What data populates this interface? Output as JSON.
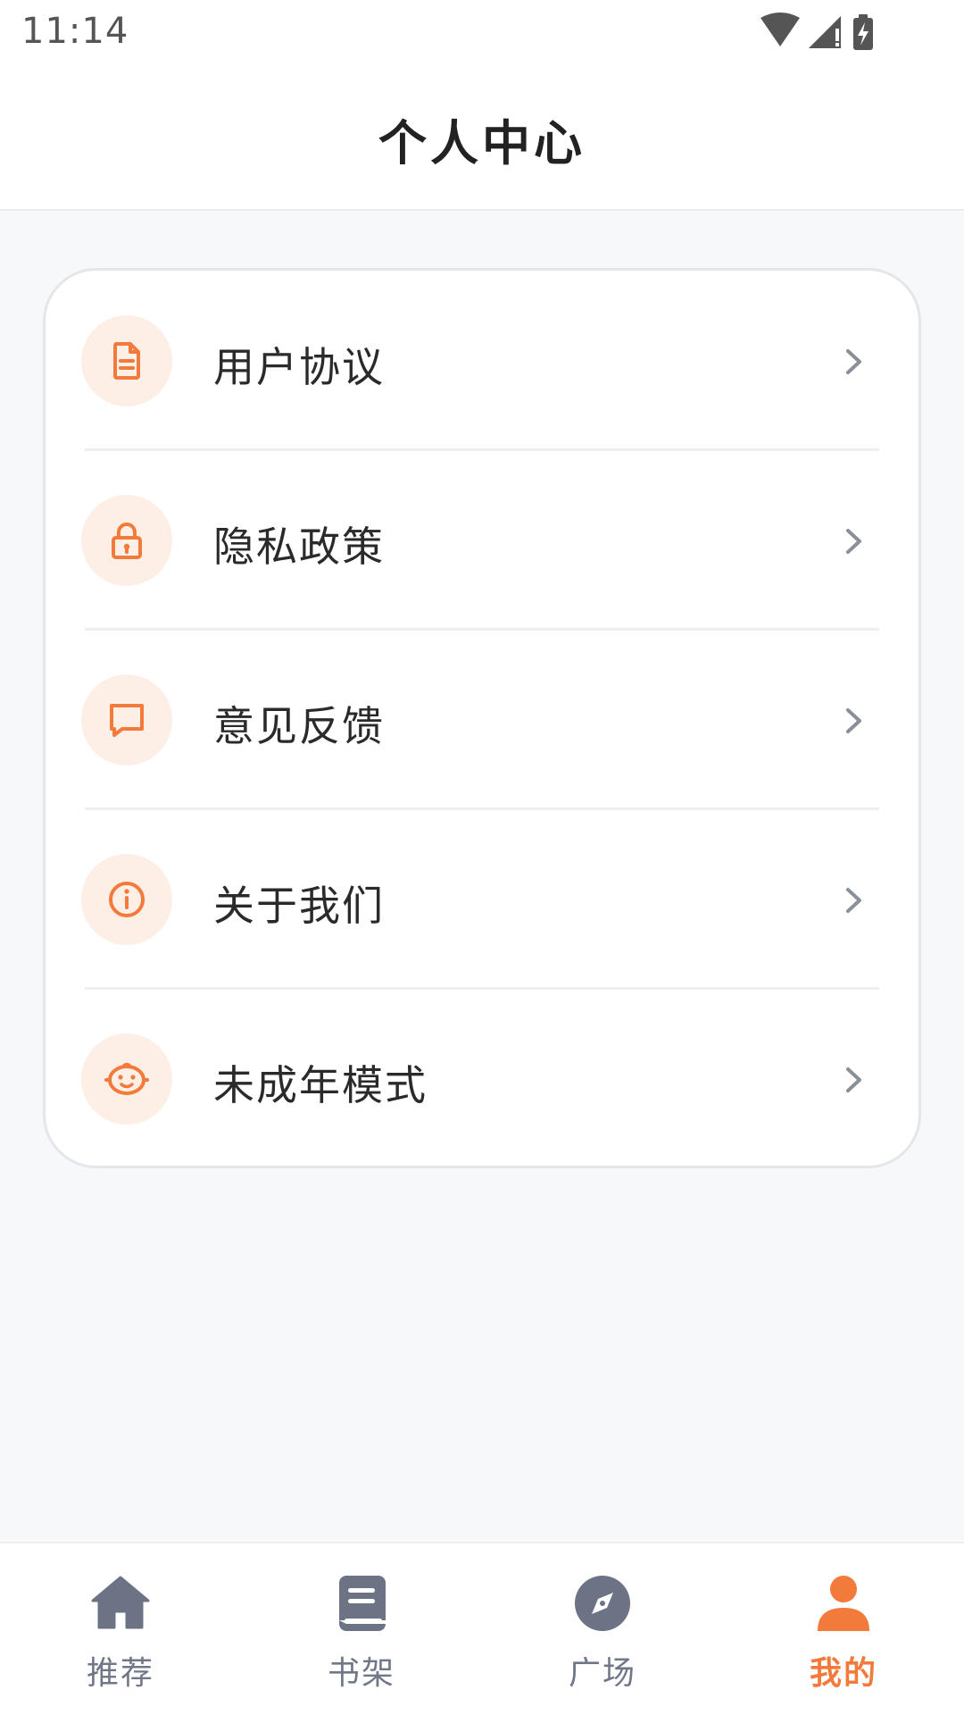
{
  "status_bar": {
    "time": "11:14",
    "icons": [
      "wifi-icon",
      "cellular-signal-icon",
      "battery-charging-icon"
    ]
  },
  "header": {
    "title": "个人中心"
  },
  "menu": {
    "items": [
      {
        "label": "用户协议",
        "icon": "document-icon"
      },
      {
        "label": "隐私政策",
        "icon": "lock-icon"
      },
      {
        "label": "意见反馈",
        "icon": "message-icon"
      },
      {
        "label": "关于我们",
        "icon": "info-icon"
      },
      {
        "label": "未成年模式",
        "icon": "child-face-icon"
      }
    ]
  },
  "bottom_nav": {
    "items": [
      {
        "label": "推荐",
        "icon": "home-icon",
        "active": false
      },
      {
        "label": "书架",
        "icon": "book-icon",
        "active": false
      },
      {
        "label": "广场",
        "icon": "compass-icon",
        "active": false
      },
      {
        "label": "我的",
        "icon": "person-icon",
        "active": true
      }
    ]
  },
  "colors": {
    "accent": "#f27a3a",
    "icon_bg": "#fdefe6",
    "nav_inactive": "#707888",
    "page_bg": "#f7f8fa"
  }
}
